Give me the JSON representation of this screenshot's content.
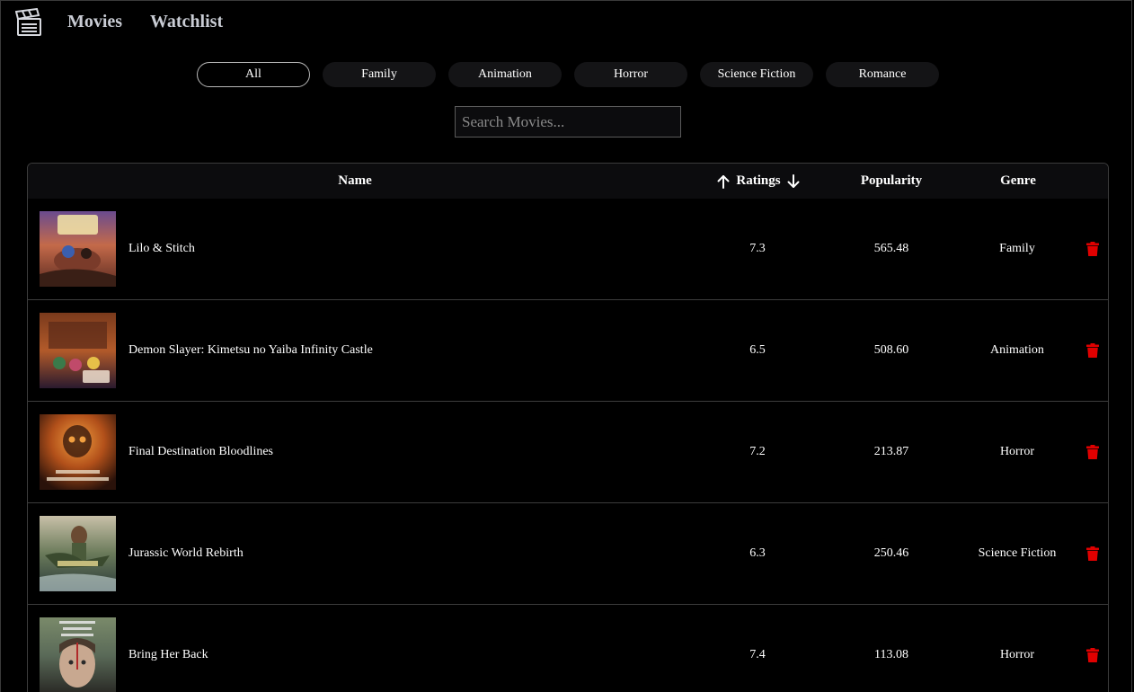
{
  "nav": {
    "logo_icon": "clapperboard-icon",
    "movies_label": "Movies",
    "watchlist_label": "Watchlist"
  },
  "genres": {
    "items": [
      "All",
      "Family",
      "Animation",
      "Horror",
      "Science Fiction",
      "Romance"
    ],
    "selected": "All"
  },
  "search": {
    "placeholder": "Search Movies...",
    "value": ""
  },
  "table": {
    "headers": {
      "name": "Name",
      "ratings": "Ratings",
      "popularity": "Popularity",
      "genre": "Genre"
    },
    "sort_icons": [
      "arrow-up-icon",
      "arrow-down-icon"
    ],
    "delete_icon": "trash-icon",
    "delete_color": "#e00000",
    "rows": [
      {
        "name": "Lilo & Stitch",
        "rating": "7.3",
        "popularity": "565.48",
        "genre": "Family"
      },
      {
        "name": "Demon Slayer: Kimetsu no Yaiba Infinity Castle",
        "rating": "6.5",
        "popularity": "508.60",
        "genre": "Animation"
      },
      {
        "name": "Final Destination Bloodlines",
        "rating": "7.2",
        "popularity": "213.87",
        "genre": "Horror"
      },
      {
        "name": "Jurassic World Rebirth",
        "rating": "6.3",
        "popularity": "250.46",
        "genre": "Science Fiction"
      },
      {
        "name": "Bring Her Back",
        "rating": "7.4",
        "popularity": "113.08",
        "genre": "Horror"
      }
    ]
  }
}
